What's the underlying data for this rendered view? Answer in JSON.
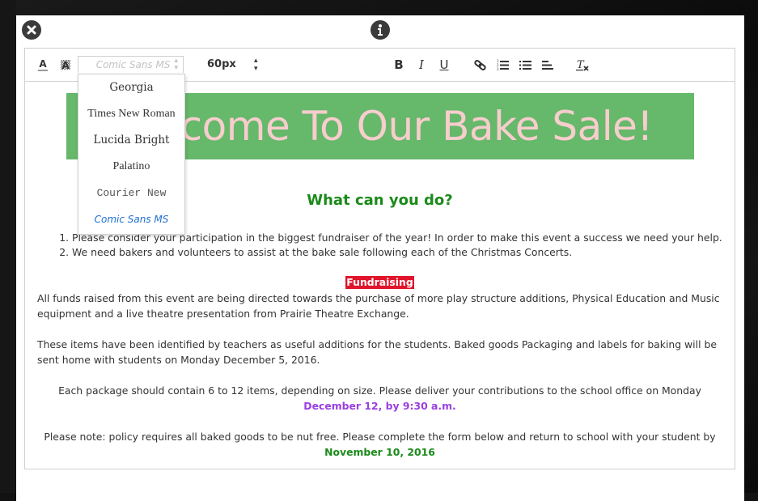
{
  "modal": {
    "close_icon": "close-circle-icon",
    "info_icon": "info-circle-icon"
  },
  "toolbar": {
    "text_color_icon": "text-color-icon",
    "bg_color_icon": "highlight-color-icon",
    "font_family": {
      "selected": "Comic Sans MS",
      "options": [
        "Georgia",
        "Times New Roman",
        "Lucida Bright",
        "Palatino",
        "Courier New",
        "Comic Sans MS"
      ],
      "active_option_color": "#1f6fd1"
    },
    "font_size": {
      "selected": "60px"
    },
    "bold_label": "B",
    "italic_label": "I",
    "underline_label": "U",
    "link_icon": "link-icon",
    "ordered_list_icon": "ordered-list-icon",
    "unordered_list_icon": "unordered-list-icon",
    "align_icon": "align-left-icon",
    "clear_format_icon": "clear-format-icon"
  },
  "content": {
    "banner": {
      "text": "Welcome To Our Bake Sale!",
      "bg_color": "#66b86b",
      "text_color": "#f8cdcd"
    },
    "heading": "What can you do?",
    "list": [
      "Please consider your participation in the biggest fundraiser of the year! In order to make this event a success we need your help.",
      "We need bakers and volunteers to assist at the bake sale following each of the Christmas Concerts."
    ],
    "badge": "Fundraising",
    "para1": "All funds raised from this event are being directed towards the purchase of more play structure additions, Physical Education and Music equipment and a live theatre presentation from Prairie Theatre Exchange.",
    "para2": "These items have been identified by teachers as useful additions for the students. Baked goods Packaging and labels for baking will be sent home with students on Monday December 5, 2016.",
    "para3": "Each package should contain 6 to 12 items, depending on size. Please deliver your contributions to the school office on Monday",
    "para3_highlight": "December 12, by 9:30 a.m.",
    "para4": "Please note: policy requires all baked goods to be nut free. Please complete the form below and return to school with your student by",
    "para4_highlight": "November 10, 2016"
  }
}
